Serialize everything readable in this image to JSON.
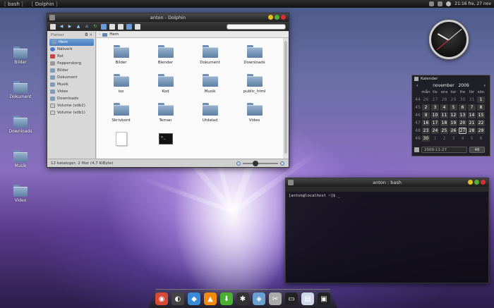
{
  "top_panel": {
    "tasks": [
      "bash",
      "Dolphin"
    ],
    "clock_text": "21:16 fre, 27 nov"
  },
  "desktop_icons": [
    {
      "label": "Bilder"
    },
    {
      "label": "Dokument"
    },
    {
      "label": "Downloads"
    },
    {
      "label": "Musik"
    },
    {
      "label": "Video"
    }
  ],
  "dolphin": {
    "title": "anton - Dolphin",
    "places_header": "Platser",
    "places": [
      {
        "label": "Hem",
        "icon": "home-folder-icon",
        "selected": true
      },
      {
        "label": "Nätverk",
        "icon": "network-icon"
      },
      {
        "label": "Rot",
        "icon": "root-folder-icon"
      },
      {
        "label": "Papperskorg",
        "icon": "trash-icon"
      },
      {
        "label": "Bilder",
        "icon": "folder-icon"
      },
      {
        "label": "Dokument",
        "icon": "folder-icon"
      },
      {
        "label": "Musik",
        "icon": "folder-icon"
      },
      {
        "label": "Video",
        "icon": "folder-icon"
      },
      {
        "label": "Downloads",
        "icon": "folder-icon"
      },
      {
        "label": "Volume (sdb2)",
        "icon": "drive-icon"
      },
      {
        "label": "Volume (sdb1)",
        "icon": "drive-icon"
      }
    ],
    "breadcrumb": "Hem",
    "files": [
      {
        "name": "Bilder",
        "type": "folder"
      },
      {
        "name": "Blender",
        "type": "folder"
      },
      {
        "name": "Dokument",
        "type": "folder"
      },
      {
        "name": "Downloads",
        "type": "folder"
      },
      {
        "name": "iso",
        "type": "folder"
      },
      {
        "name": "Kod",
        "type": "folder"
      },
      {
        "name": "Musik",
        "type": "folder"
      },
      {
        "name": "public_html",
        "type": "folder"
      },
      {
        "name": "Skrivbord",
        "type": "folder"
      },
      {
        "name": "Teman",
        "type": "folder"
      },
      {
        "name": "Utdelad",
        "type": "folder"
      },
      {
        "name": "Video",
        "type": "folder"
      },
      {
        "name": "",
        "type": "document"
      },
      {
        "name": "",
        "type": "terminal"
      }
    ],
    "status": "12 kataloger, 2 filer (4,7 KiByte)"
  },
  "calendar": {
    "title": "Kalender",
    "month": "november",
    "year": "2009",
    "weekday_headers": [
      "mån",
      "tis",
      "ons",
      "tor",
      "fre",
      "lör",
      "sön"
    ],
    "weeks": [
      {
        "wk": "44",
        "days": [
          "26",
          "27",
          "28",
          "29",
          "30",
          "31",
          "1"
        ],
        "out": [
          true,
          true,
          true,
          true,
          true,
          true,
          false
        ]
      },
      {
        "wk": "45",
        "days": [
          "2",
          "3",
          "4",
          "5",
          "6",
          "7",
          "8"
        ],
        "out": [
          false,
          false,
          false,
          false,
          false,
          false,
          false
        ]
      },
      {
        "wk": "46",
        "days": [
          "9",
          "10",
          "11",
          "12",
          "13",
          "14",
          "15"
        ],
        "out": [
          false,
          false,
          false,
          false,
          false,
          false,
          false
        ]
      },
      {
        "wk": "47",
        "days": [
          "16",
          "17",
          "18",
          "19",
          "20",
          "21",
          "22"
        ],
        "out": [
          false,
          false,
          false,
          false,
          false,
          false,
          false
        ]
      },
      {
        "wk": "48",
        "days": [
          "23",
          "24",
          "25",
          "26",
          "27",
          "28",
          "29"
        ],
        "out": [
          false,
          false,
          false,
          false,
          false,
          false,
          false
        ]
      },
      {
        "wk": "49",
        "days": [
          "30",
          "1",
          "2",
          "3",
          "4",
          "5",
          "6"
        ],
        "out": [
          false,
          true,
          true,
          true,
          true,
          true,
          true
        ]
      }
    ],
    "today": "27",
    "date_value": "2009-11-27",
    "week_value": "48"
  },
  "terminal": {
    "title": "anton : bash",
    "prompt": "[anton@localhost ~]$ _"
  },
  "dock": {
    "items": [
      {
        "icon": "chrome-icon",
        "color": "#d84a38"
      },
      {
        "icon": "dolphin-icon",
        "color": "#444"
      },
      {
        "icon": "chat-icon",
        "color": "#3a8ad8"
      },
      {
        "icon": "vlc-icon",
        "color": "#f08a10"
      },
      {
        "icon": "download-icon",
        "color": "#4ab030"
      },
      {
        "icon": "settings-icon",
        "color": "#333"
      },
      {
        "icon": "image-editor-icon",
        "color": "#6aa0d0"
      },
      {
        "icon": "tools-icon",
        "color": "#aaa"
      },
      {
        "icon": "terminal-icon",
        "color": "#222"
      },
      {
        "icon": "text-editor-icon",
        "color": "#cfd8e8"
      },
      {
        "icon": "console-icon",
        "color": "#222"
      }
    ]
  }
}
